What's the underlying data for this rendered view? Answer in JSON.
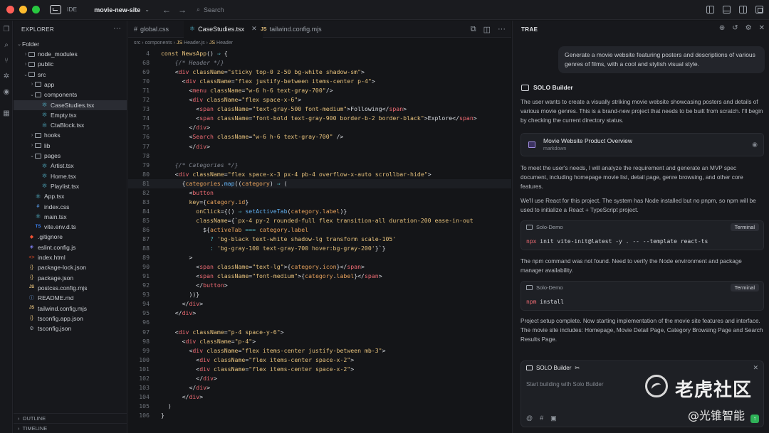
{
  "titlebar": {
    "app_label": "IDE",
    "project_name": "movie-new-site",
    "search_placeholder": "Search"
  },
  "explorer": {
    "header": "EXPLORER",
    "root": "Folder",
    "items": [
      {
        "label": "node_modules",
        "type": "folder",
        "depth": 1,
        "state": "closed"
      },
      {
        "label": "public",
        "type": "folder",
        "depth": 1,
        "state": "closed"
      },
      {
        "label": "src",
        "type": "folder",
        "depth": 1,
        "state": "open"
      },
      {
        "label": "app",
        "type": "folder",
        "depth": 2,
        "state": "closed"
      },
      {
        "label": "components",
        "type": "folder",
        "depth": 2,
        "state": "open"
      },
      {
        "label": "CaseStudies.tsx",
        "type": "react",
        "depth": 3,
        "selected": true
      },
      {
        "label": "Empty.tsx",
        "type": "react",
        "depth": 3
      },
      {
        "label": "CtaBlock.tsx",
        "type": "react",
        "depth": 3
      },
      {
        "label": "hooks",
        "type": "folder",
        "depth": 2,
        "state": "closed"
      },
      {
        "label": "lib",
        "type": "folder",
        "depth": 2,
        "state": "closed"
      },
      {
        "label": "pages",
        "type": "folder",
        "depth": 2,
        "state": "open"
      },
      {
        "label": "Artist.tsx",
        "type": "react",
        "depth": 3
      },
      {
        "label": "Home.tsx",
        "type": "react",
        "depth": 3
      },
      {
        "label": "Playlist.tsx",
        "type": "react",
        "depth": 3
      },
      {
        "label": "App.tsx",
        "type": "react",
        "depth": 2
      },
      {
        "label": "index.css",
        "type": "css",
        "depth": 2
      },
      {
        "label": "main.tsx",
        "type": "react",
        "depth": 2
      },
      {
        "label": "vite.env.d.ts",
        "type": "ts",
        "depth": 2
      },
      {
        "label": ".gitignore",
        "type": "git",
        "depth": 1
      },
      {
        "label": "eslint.config.js",
        "type": "eslint",
        "depth": 1
      },
      {
        "label": "index.html",
        "type": "html",
        "depth": 1
      },
      {
        "label": "package-lock.json",
        "type": "json",
        "depth": 1
      },
      {
        "label": "package.json",
        "type": "json",
        "depth": 1
      },
      {
        "label": "postcss.config.mjs",
        "type": "js",
        "depth": 1
      },
      {
        "label": "README.md",
        "type": "md",
        "depth": 1
      },
      {
        "label": "tailwind.config.mjs",
        "type": "js",
        "depth": 1
      },
      {
        "label": "tsconfig.app.json",
        "type": "json",
        "depth": 1
      },
      {
        "label": "tsconfig.json",
        "type": "gear",
        "depth": 1
      }
    ],
    "outline": "OUTLINE",
    "timeline": "TIMELINE"
  },
  "editor": {
    "tabs": [
      {
        "label": "global.css",
        "icon": "#"
      },
      {
        "label": "CaseStudies.tsx",
        "icon": "react",
        "active": true
      },
      {
        "label": "tailwind.config.mjs",
        "icon": "JS"
      }
    ],
    "breadcrumb": [
      "src",
      "components",
      "Header.js",
      "Header"
    ],
    "lines": [
      {
        "n": "4",
        "html": "<span class='k'>const</span> <span class='a'>NewsApp</span><span class='p'>() </span><span class='o'>⇒</span><span class='p'> {</span>"
      },
      {
        "n": "68",
        "html": "    <span class='c'>{/* Header */}</span>"
      },
      {
        "n": "69",
        "html": "    <span class='p'>&lt;</span><span class='t'>div</span> <span class='a'>className</span><span class='p'>=</span><span class='s'>\"sticky top-0 z-50 bg-white shadow-sm\"</span><span class='p'>&gt;</span>"
      },
      {
        "n": "70",
        "html": "      <span class='p'>&lt;</span><span class='t'>div</span> <span class='a'>className</span><span class='p'>=</span><span class='s'>\"flex justify-between items-center p-4\"</span><span class='p'>&gt;</span>"
      },
      {
        "n": "71",
        "html": "        <span class='p'>&lt;</span><span class='t'>menu</span> <span class='a'>className</span><span class='p'>=</span><span class='s'>\"w-6 h-6 text-gray-700\"</span><span class='p'>/&gt;</span>"
      },
      {
        "n": "72",
        "html": "        <span class='p'>&lt;</span><span class='t'>div</span> <span class='a'>className</span><span class='p'>=</span><span class='s'>\"flex space-x-6\"</span><span class='p'>&gt;</span>"
      },
      {
        "n": "73",
        "html": "          <span class='p'>&lt;</span><span class='t'>span</span> <span class='a'>className</span><span class='p'>=</span><span class='s'>\"text-gray-500 font-medium\"</span><span class='p'>&gt;Following&lt;/</span><span class='t'>span</span><span class='p'>&gt;</span>"
      },
      {
        "n": "74",
        "html": "          <span class='p'>&lt;</span><span class='t'>span</span> <span class='a'>className</span><span class='p'>=</span><span class='s'>\"font-bold text-gray-900 border-b-2 border-black\"</span><span class='p'>&gt;Explore&lt;/</span><span class='t'>span</span><span class='p'>&gt;</span>"
      },
      {
        "n": "75",
        "html": "        <span class='p'>&lt;/</span><span class='t'>div</span><span class='p'>&gt;</span>"
      },
      {
        "n": "76",
        "html": "        <span class='p'>&lt;</span><span class='t'>Search</span> <span class='a'>className</span><span class='p'>=</span><span class='s'>\"w-6 h-6 text-gray-700\"</span><span class='p'> /&gt;</span>"
      },
      {
        "n": "77",
        "html": "        <span class='p'>&lt;/</span><span class='t'>div</span><span class='p'>&gt;</span>"
      },
      {
        "n": "78",
        "html": ""
      },
      {
        "n": "79",
        "html": "    <span class='c'>{/* Categories */}</span>"
      },
      {
        "n": "80",
        "html": "    <span class='p'>&lt;</span><span class='t'>div</span> <span class='a'>className</span><span class='p'>=</span><span class='s'>\"flex space-x-3 px-4 pb-4 overflow-x-auto scrollbar-hide\"</span><span class='p'>&gt;</span>"
      },
      {
        "n": "81",
        "html": "      <span class='p'>{</span><span class='v'>categories</span><span class='p'>.</span><span class='f'>map</span><span class='p'>((</span><span class='v'>category</span><span class='p'>) </span><span class='o'>⇒</span><span class='p'> (</span>",
        "current": true
      },
      {
        "n": "82",
        "html": "        <span class='p'>&lt;</span><span class='t'>button</span>"
      },
      {
        "n": "83",
        "html": "        <span class='a'>key</span><span class='p'>={</span><span class='v'>category</span><span class='p'>.</span><span class='v'>id</span><span class='p'>}</span>"
      },
      {
        "n": "84",
        "html": "          <span class='a'>onClick</span><span class='p'>={() </span><span class='o'>⇒</span> <span class='f'>setActiveTab</span><span class='p'>(</span><span class='v'>category</span><span class='p'>.</span><span class='v'>label</span><span class='p'>)}</span>"
      },
      {
        "n": "85",
        "html": "          <span class='a'>className</span><span class='p'>={`</span><span class='s'>px-4 py-2 rounded-full flex transition-all duration-200 ease-in-out</span>"
      },
      {
        "n": "86",
        "html": "            <span class='p'>${</span><span class='v'>activeTab</span> <span class='o'>===</span> <span class='v'>category</span><span class='p'>.</span><span class='v'>label</span>"
      },
      {
        "n": "87",
        "html": "              <span class='o'>?</span> <span class='s'>'bg-black text-white shadow-lg transform scale-105'</span>"
      },
      {
        "n": "88",
        "html": "              <span class='o'>:</span> <span class='s'>'bg-gray-100 text-gray-700 hover:bg-gray-200'</span><span class='p'>}`}</span>"
      },
      {
        "n": "89",
        "html": "        <span class='p'>&gt;</span>"
      },
      {
        "n": "90",
        "html": "          <span class='p'>&lt;</span><span class='t'>span</span> <span class='a'>className</span><span class='p'>=</span><span class='s'>\"text-lg\"</span><span class='p'>&gt;{</span><span class='v'>category</span><span class='p'>.</span><span class='v'>icon</span><span class='p'>}&lt;/</span><span class='t'>span</span><span class='p'>&gt;</span>"
      },
      {
        "n": "91",
        "html": "          <span class='p'>&lt;</span><span class='t'>span</span> <span class='a'>className</span><span class='p'>=</span><span class='s'>\"font-medium\"</span><span class='p'>&gt;{</span><span class='v'>category</span><span class='p'>.</span><span class='v'>label</span><span class='p'>}&lt;/</span><span class='t'>span</span><span class='p'>&gt;</span>"
      },
      {
        "n": "92",
        "html": "          <span class='p'>&lt;/</span><span class='t'>button</span><span class='p'>&gt;</span>"
      },
      {
        "n": "93",
        "html": "        <span class='p'>))}</span>"
      },
      {
        "n": "94",
        "html": "      <span class='p'>&lt;/</span><span class='t'>div</span><span class='p'>&gt;</span>"
      },
      {
        "n": "95",
        "html": "    <span class='p'>&lt;/</span><span class='t'>div</span><span class='p'>&gt;</span>"
      },
      {
        "n": "96",
        "html": ""
      },
      {
        "n": "97",
        "html": "    <span class='p'>&lt;</span><span class='t'>div</span> <span class='a'>className</span><span class='p'>=</span><span class='s'>\"p-4 space-y-6\"</span><span class='p'>&gt;</span>"
      },
      {
        "n": "98",
        "html": "      <span class='p'>&lt;</span><span class='t'>div</span> <span class='a'>className</span><span class='p'>=</span><span class='s'>\"p-4\"</span><span class='p'>&gt;</span>"
      },
      {
        "n": "99",
        "html": "        <span class='p'>&lt;</span><span class='t'>div</span> <span class='a'>className</span><span class='p'>=</span><span class='s'>\"flex items-center justify-between mb-3\"</span><span class='p'>&gt;</span>"
      },
      {
        "n": "100",
        "html": "          <span class='p'>&lt;</span><span class='t'>div</span> <span class='a'>className</span><span class='p'>=</span><span class='s'>\"flex items-center space-x-2\"</span><span class='p'>&gt;</span>"
      },
      {
        "n": "101",
        "html": "          <span class='p'>&lt;</span><span class='t'>div</span> <span class='a'>className</span><span class='p'>=</span><span class='s'>\"flex items-center space-x-2\"</span><span class='p'>&gt;</span>"
      },
      {
        "n": "102",
        "html": "          <span class='p'>&lt;/</span><span class='t'>div</span><span class='p'>&gt;</span>"
      },
      {
        "n": "103",
        "html": "        <span class='p'>&lt;/</span><span class='t'>div</span><span class='p'>&gt;</span>"
      },
      {
        "n": "104",
        "html": "      <span class='p'>&lt;/</span><span class='t'>div</span><span class='p'>&gt;</span>"
      },
      {
        "n": "105",
        "html": "  <span class='p'>)</span>"
      },
      {
        "n": "106",
        "html": "<span class='p'>}</span>"
      }
    ]
  },
  "panel": {
    "title": "TRAE",
    "user_message": "Generate a movie website featuring posters and descriptions of various genres of films, with a cool and stylish visual style.",
    "agent_name": "SOLO Builder",
    "para1": "The user wants to create a visually striking movie website showcasing posters and details of various movie genres. This is a brand-new project that needs to be built from scratch. I'll begin by checking the current directory status.",
    "doc_title": "Movie Website Product Overview",
    "doc_sub": "markdown",
    "para2": "To meet the user's needs, I will analyze the requirement and generate an MVP spec document, including homepage movie list, detail page, genre browsing, and other core features.",
    "para3": "We'll use React for this project. The system has Node installed but no pnpm, so npm will be used to initialize a React + TypeScript project.",
    "term1": {
      "name": "Solo-Demo",
      "badge": "Terminal",
      "pm": "npx",
      "cmd": " init vite-init@latest -y . -- --template react-ts"
    },
    "para4": "The npm command was not found. Need to verify the Node environment and package manager availability.",
    "term2": {
      "name": "Solo-Demo",
      "badge": "Terminal",
      "pm": "npm",
      "cmd": " install"
    },
    "para5": "Project setup complete. Now starting implementation of the movie site features and interface. The movie site includes: Homepage, Movie Detail Page, Category Browsing Page and Search Results Page.",
    "composer": {
      "title": "SOLO Builder",
      "placeholder": "Start building with Solo Builder"
    }
  },
  "watermark": {
    "line1": "老虎社区",
    "line2": "@光锥智能"
  }
}
